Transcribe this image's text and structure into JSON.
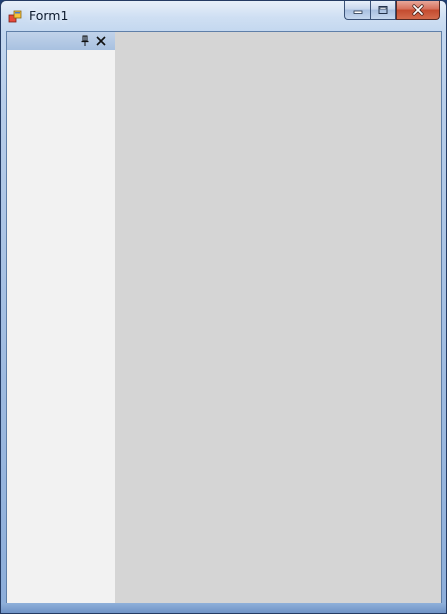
{
  "window": {
    "title": "Form1",
    "icons": {
      "app": "windows-form-icon",
      "minimize": "minimize-icon",
      "maximize": "maximize-icon",
      "close": "close-icon"
    }
  },
  "dock_panel": {
    "icons": {
      "pin": "pin-icon",
      "close": "close-icon"
    }
  },
  "colors": {
    "panel_background": "#f2f2f2",
    "document_background": "#d5d5d5",
    "dock_header": "#a8c1e0",
    "close_button": "#c44b2f"
  }
}
